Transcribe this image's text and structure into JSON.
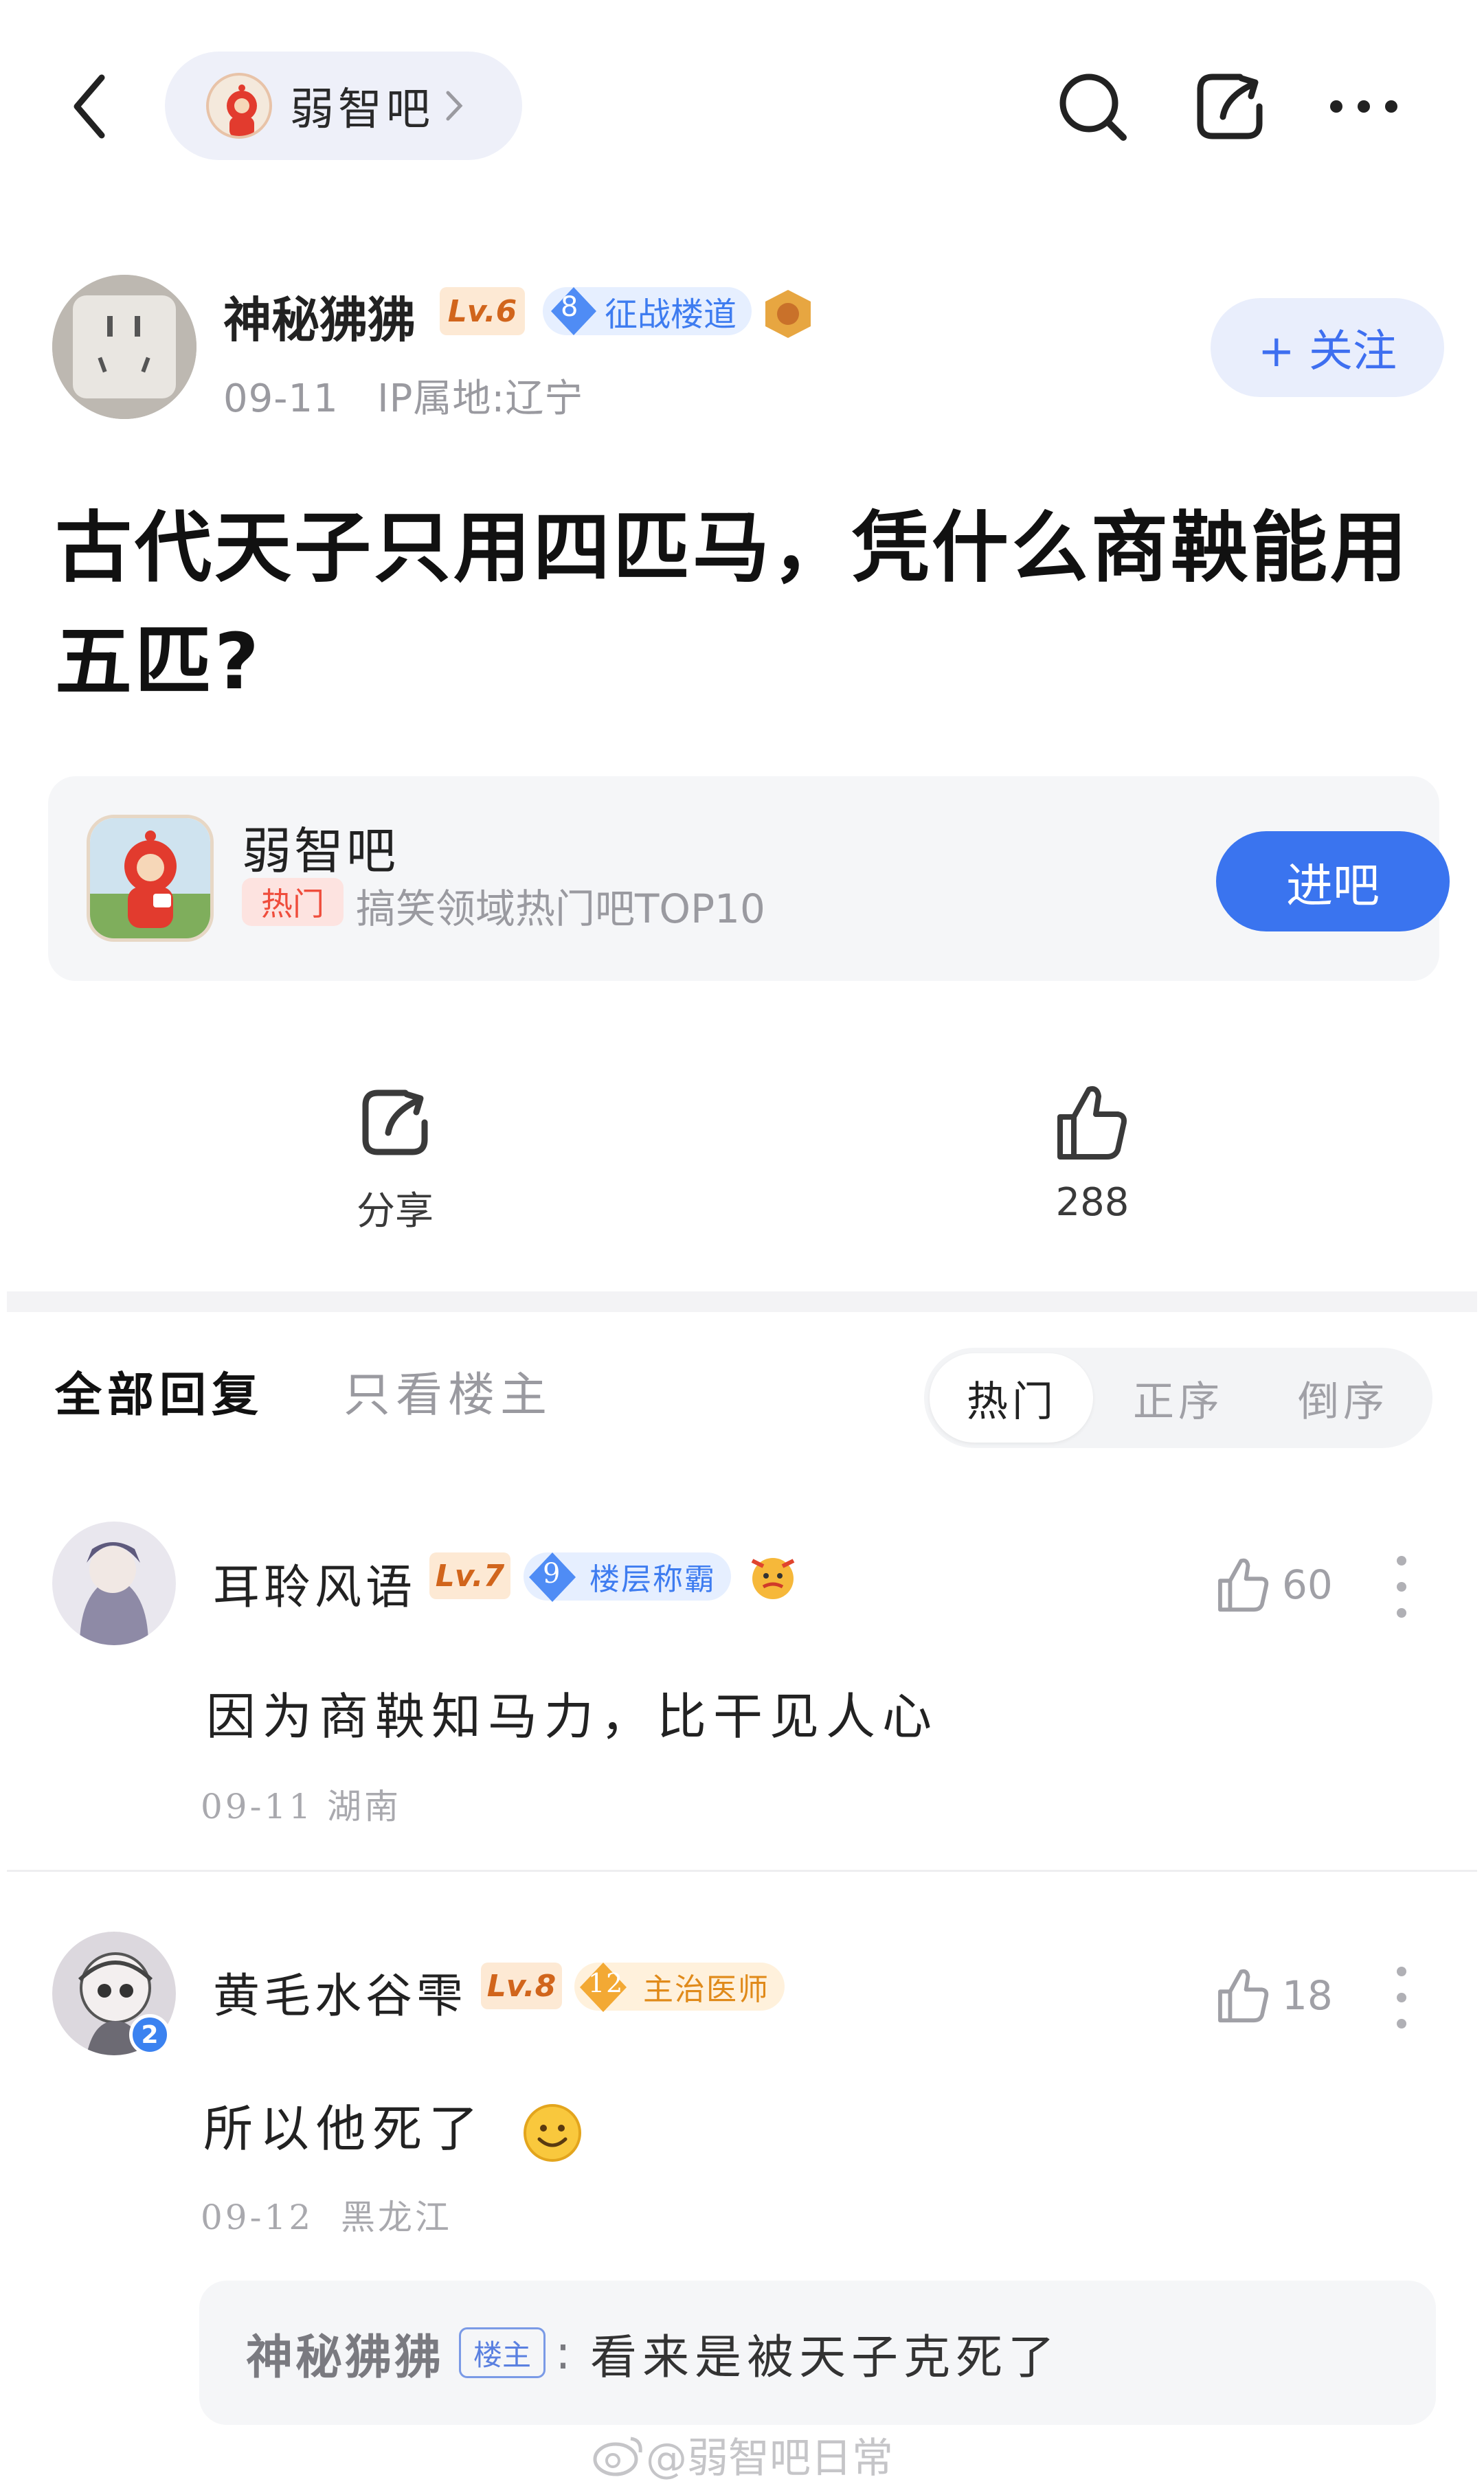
{
  "header": {
    "forum_name": "弱智吧"
  },
  "author": {
    "name": "神秘狒狒",
    "level": "Lv.6",
    "title_num": "8",
    "title": "征战楼道",
    "date": "09-11",
    "ip": "IP属地:辽宁",
    "follow_label": "+ 关注"
  },
  "post": {
    "title": "古代天子只用四匹马，凭什么商鞅能用五匹?"
  },
  "forum_card": {
    "name": "弱智吧",
    "tag": "热门",
    "desc": "搞笑领域热门吧TOP10",
    "enter_label": "进吧"
  },
  "actions": {
    "share_label": "分享",
    "like_count": "288"
  },
  "replies_header": {
    "tab_all": "全部回复",
    "tab_op": "只看楼主",
    "sort": [
      "热门",
      "正序",
      "倒序"
    ],
    "active_sort": "热门"
  },
  "comments": [
    {
      "name": "耳聆风语",
      "level": "Lv.7",
      "title_num": "9",
      "title": "楼层称霸",
      "likes": "60",
      "text": "因为商鞅知马力，比干见人心",
      "date": "09-11",
      "location": "湖南"
    },
    {
      "name": "黄毛水谷雫",
      "level": "Lv.8",
      "title_num": "12",
      "title": "主治医师",
      "avatar_badge": "2",
      "likes": "18",
      "text": "所以他死了",
      "date": "09-12",
      "location": "黑龙江",
      "sub_reply": {
        "name": "神秘狒狒",
        "tag": "楼主",
        "colon": ":",
        "text": "看来是被天子克死了"
      }
    }
  ],
  "watermark": "@弱智吧日常",
  "colors": {
    "accent_blue": "#3a74ef",
    "level_orange": "#d1651c",
    "hot_red": "#ef4d3c",
    "muted_gray": "#9a9aa0"
  }
}
